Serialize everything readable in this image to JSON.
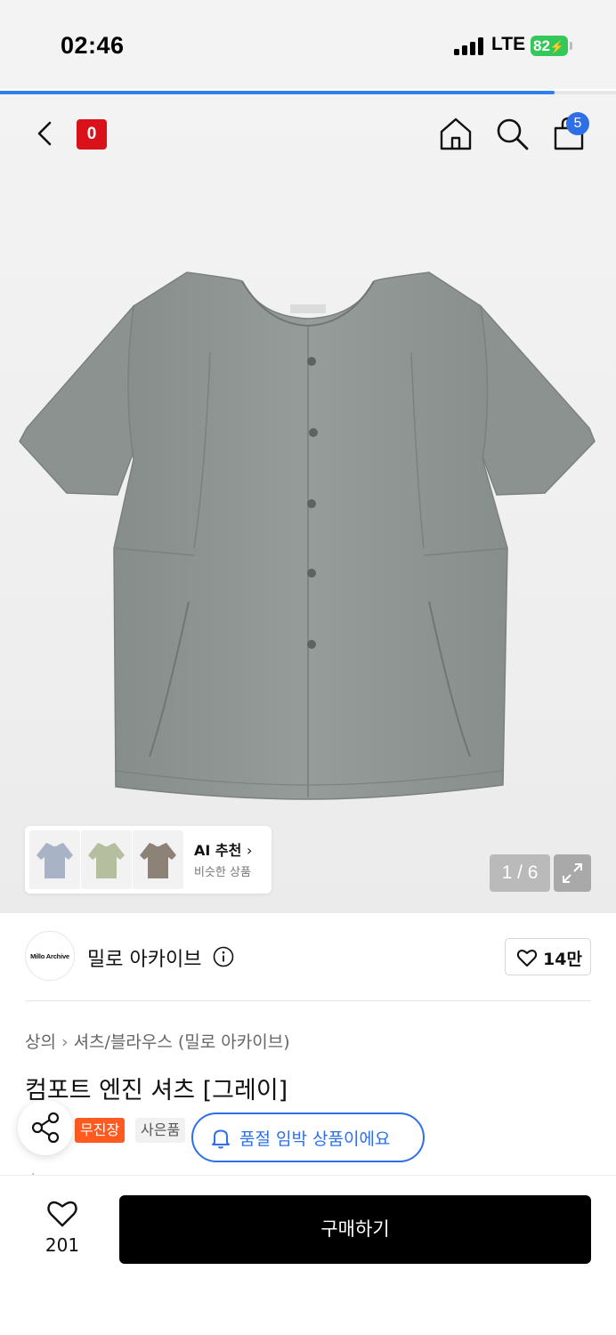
{
  "status_bar": {
    "time": "02:46",
    "network": "LTE",
    "battery": "82"
  },
  "load_progress": 0.9,
  "header": {
    "brand_badge": "0",
    "cart_count": "5",
    "icons": [
      "chevron-left-icon",
      "home-icon",
      "search-icon",
      "bag-icon"
    ]
  },
  "gallery": {
    "counter": "1 / 6",
    "ai_reco": {
      "title": "AI 추천",
      "subtitle": "비슷한 상품"
    }
  },
  "brand": {
    "logo_text": "Millo Archive",
    "name": "밀로 아카이브",
    "likes": "14만"
  },
  "breadcrumb": [
    "상의",
    "셔츠/블라우스 (밀로 아카이브)"
  ],
  "product": {
    "title": "컴포트 엔진 셔츠 [그레이]",
    "tags": [
      "무진장",
      "사은품"
    ]
  },
  "restock_notice": "품절 임박 상품이에요",
  "footer": {
    "wish_count": "201",
    "buy_label": "구매하기"
  },
  "colors": {
    "accent_blue": "#2f6fe6",
    "progress_blue": "#2f80ed",
    "brand_red": "#d9111a",
    "tag_orange": "#ff5a1f",
    "battery_green": "#34c759",
    "shirt_gray": "#8f9694"
  }
}
